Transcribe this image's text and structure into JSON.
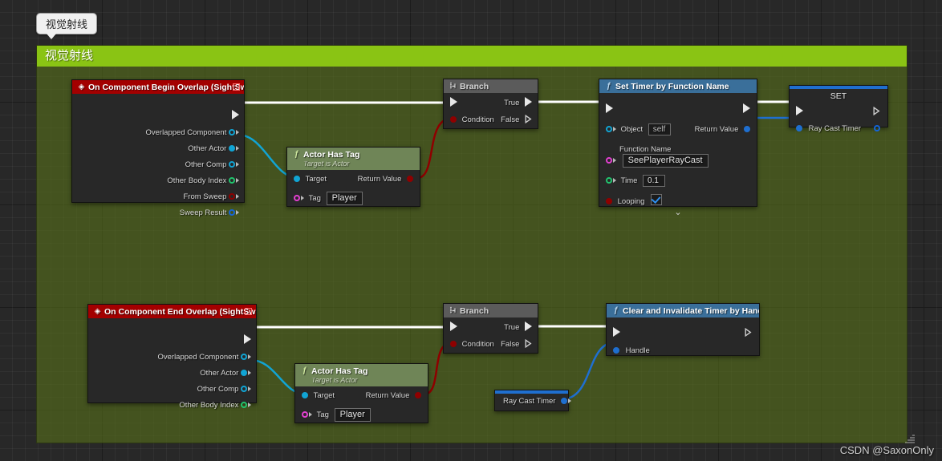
{
  "window": {
    "bubble_label": "视觉射线",
    "watermark": "CSDN @SaxonOnly"
  },
  "comment": {
    "title": "视觉射线",
    "color": "#8ac414"
  },
  "nodes": {
    "begin_overlap": {
      "title": "On Component Begin Overlap (SightSwitch)",
      "icon": "event-diamond-icon",
      "header_color": "#a30000",
      "pins": [
        {
          "label": "Overlapped Component",
          "type": "object"
        },
        {
          "label": "Other Actor",
          "type": "object-filled"
        },
        {
          "label": "Other Comp",
          "type": "object"
        },
        {
          "label": "Other Body Index",
          "type": "int"
        },
        {
          "label": "From Sweep",
          "type": "bool"
        },
        {
          "label": "Sweep Result",
          "type": "struct"
        }
      ]
    },
    "actor_has_tag_1": {
      "title": "Actor Has Tag",
      "subtitle": "Target is Actor",
      "header_color": "#6f8557",
      "target_label": "Target",
      "return_label": "Return Value",
      "tag_label": "Tag",
      "tag_value": "Player"
    },
    "branch_1": {
      "title": "Branch",
      "condition_label": "Condition",
      "true_label": "True",
      "false_label": "False",
      "header_color": "#5b5b5b"
    },
    "set_timer": {
      "title": "Set Timer by Function Name",
      "header_color": "#3a6f9a",
      "object_label": "Object",
      "object_value": "self",
      "function_name_label": "Function Name",
      "function_name_value": "SeePlayerRayCast",
      "time_label": "Time",
      "time_value": "0.1",
      "looping_label": "Looping",
      "looping_checked": true,
      "return_label": "Return Value",
      "expand_icon": "chevron-down-icon"
    },
    "set_node": {
      "title": "SET",
      "variable_label": "Ray Cast Timer",
      "accent": "#1f6fd0"
    },
    "end_overlap": {
      "title": "On Component End Overlap (SightSwitch)",
      "icon": "event-diamond-icon",
      "header_color": "#a30000",
      "pins": [
        {
          "label": "Overlapped Component",
          "type": "object"
        },
        {
          "label": "Other Actor",
          "type": "object-filled"
        },
        {
          "label": "Other Comp",
          "type": "object"
        },
        {
          "label": "Other Body Index",
          "type": "int"
        }
      ]
    },
    "actor_has_tag_2": {
      "title": "Actor Has Tag",
      "subtitle": "Target is Actor",
      "header_color": "#6f8557",
      "target_label": "Target",
      "return_label": "Return Value",
      "tag_label": "Tag",
      "tag_value": "Player"
    },
    "branch_2": {
      "title": "Branch",
      "condition_label": "Condition",
      "true_label": "True",
      "false_label": "False",
      "header_color": "#5b5b5b"
    },
    "clear_timer": {
      "title": "Clear and Invalidate Timer by Handle",
      "header_color": "#3a6f9a",
      "handle_label": "Handle"
    },
    "get_ray_cast_timer": {
      "variable_label": "Ray Cast Timer",
      "accent": "#1f6fd0"
    }
  },
  "wire_colors": {
    "exec": "#ffffff",
    "bool": "#8f0000",
    "object": "#11a4d4",
    "struct": "#1565d8"
  }
}
